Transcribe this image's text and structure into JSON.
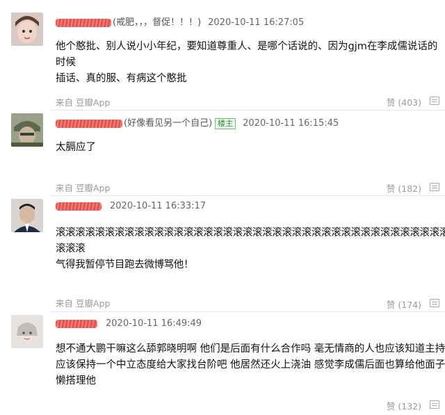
{
  "comments": [
    {
      "nick_tail": "(戒肥，，，督促！！！)",
      "timestamp": "2020-10-11 16:27:05",
      "text_lines": [
        "他个憨批、别人说小小年纪，要知道尊重人、是哪个话说的、因为gjm在李成儒说话的时候",
        "插话、真的服、有病这个憨批"
      ],
      "source": "来自 豆瓣App",
      "like": "赞 (403)"
    },
    {
      "nick_tail": "(好像看见另一个自己)",
      "badge": "楼主",
      "timestamp": "2020-10-11 16:15:45",
      "text_lines": [
        "太膈应了"
      ],
      "source": "来自 豆瓣App",
      "like": "赞 (182)"
    },
    {
      "timestamp": "2020-10-11 16:33:17",
      "text_lines": [
        "滚滚滚滚滚滚滚滚滚滚滚滚滚滚滚滚滚滚滚滚滚滚滚滚滚滚滚滚滚滚滚滚滚滚滚滚滚滚滚滚",
        "滚滚滚",
        "气得我暂停节目跑去微博骂他！"
      ],
      "source": "来自 豆瓣App",
      "like": "赞 (174)"
    },
    {
      "timestamp": "2020-10-11 16:49:49",
      "text_lines": [
        "想不通大鹏干嘛这么舔郭晓明啊 他们是后面有什么合作吗 毫无情商的人也应该知道主持人",
        "应该保持一个中立态度给大家找台阶吧 他居然还火上浇油 感觉李成儒后面也算给他面子了",
        "懒搭理他"
      ],
      "like": "赞 (132)"
    }
  ]
}
